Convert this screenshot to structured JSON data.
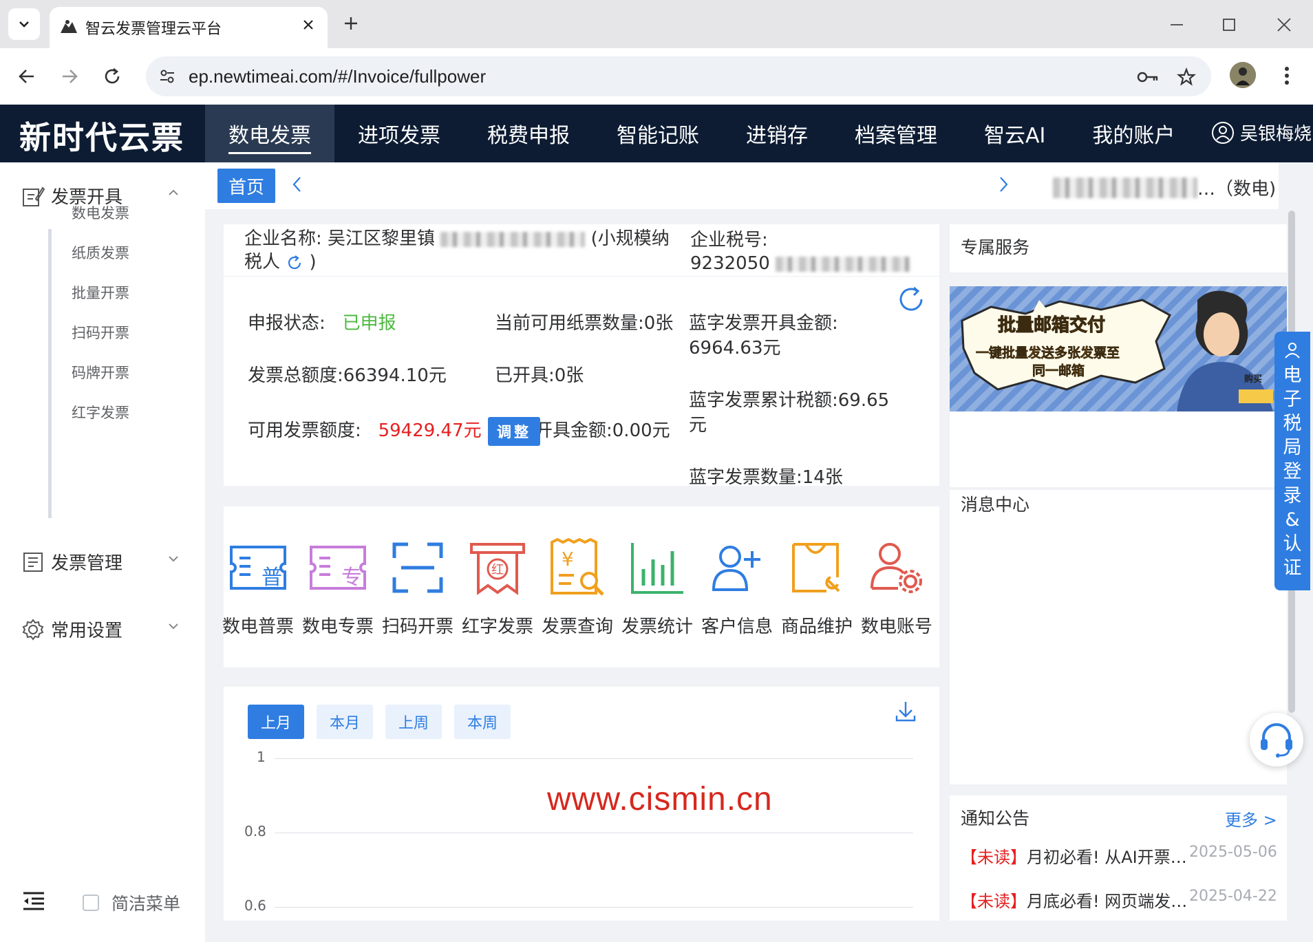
{
  "browser": {
    "tab_title": "智云发票管理云平台",
    "url": "ep.newtimeai.com/#/Invoice/fullpower"
  },
  "app": {
    "logo": "新时代云票",
    "nav": [
      "数电发票",
      "进项发票",
      "税费申报",
      "智能记账",
      "进销存",
      "档案管理",
      "智云AI",
      "我的账户"
    ],
    "active_nav": "数电发票",
    "user_name": "吴银梅烧"
  },
  "sidebar": {
    "group1": "发票开具",
    "group1_items": [
      "数电发票",
      "纸质发票",
      "批量开票",
      "扫码开票",
      "码牌开票",
      "红字发票"
    ],
    "group2": "发票管理",
    "group3": "常用设置",
    "simple_menu": "简洁菜单"
  },
  "breadcrumb": {
    "home": "首页",
    "company_suffix": "…（数电)"
  },
  "company": {
    "name_label": "企业名称:",
    "name_prefix": "吴江区黎里镇",
    "name_type": "(小规模纳",
    "name_type2": "税人",
    "name_close": ")",
    "tax_label": "企业税号:",
    "tax_prefix": "9232050"
  },
  "stats": {
    "declare_label": "申报状态:",
    "declare_value": "已申报",
    "paper_label": "当前可用纸票数量:",
    "paper_value": "0张",
    "blue_amount_label": "蓝字发票开具金额:",
    "blue_amount_value": "6964.63元",
    "total_label": "发票总额度:",
    "total_value": "66394.10元",
    "issued_label": "已开具:",
    "issued_value": "0张",
    "blue_tax_label": "蓝字发票累计税额:",
    "blue_tax_value": "69.65",
    "blue_tax_unit": "元",
    "available_label": "可用发票额度:",
    "available_value": "59429.47元",
    "adjust_btn": "调整",
    "issued_amount_label": "开具金额:",
    "issued_amount_value": "0.00元",
    "blue_count_label": "蓝字发票数量:",
    "blue_count_value": "14张"
  },
  "quick_actions": [
    {
      "label": "数电普票",
      "icon": "ordinary-invoice-icon"
    },
    {
      "label": "数电专票",
      "icon": "special-invoice-icon"
    },
    {
      "label": "扫码开票",
      "icon": "scan-icon"
    },
    {
      "label": "红字发票",
      "icon": "red-invoice-icon"
    },
    {
      "label": "发票查询",
      "icon": "invoice-search-icon"
    },
    {
      "label": "发票统计",
      "icon": "bar-chart-icon"
    },
    {
      "label": "客户信息",
      "icon": "add-user-icon"
    },
    {
      "label": "商品维护",
      "icon": "bag-wrench-icon"
    },
    {
      "label": "数电账号",
      "icon": "user-gear-icon"
    }
  ],
  "chart": {
    "periods": [
      "上月",
      "本月",
      "上周",
      "本周"
    ],
    "active_period": "上月",
    "watermark": "www.cismin.cn"
  },
  "chart_data": {
    "type": "line",
    "ylim": [
      0.6,
      1
    ],
    "yticks": [
      "1",
      "0.8",
      "0.6"
    ],
    "series": []
  },
  "right_panel": {
    "service_title": "专属服务",
    "banner_title": "批量邮箱交付",
    "banner_sub1": "一键批量发送多张发票至",
    "banner_sub2": "同一邮箱",
    "banner_buy": "购买",
    "message_title": "消息中心",
    "notice_title": "通知公告",
    "more": "更多 >",
    "notices": [
      {
        "tag": "【未读】",
        "text": "月初必看! 从AI开票…",
        "date": "2025-05-06"
      },
      {
        "tag": "【未读】",
        "text": "月底必看! 网页端发…",
        "date": "2025-04-22"
      }
    ]
  },
  "floating": {
    "login_text": "电子税局登录&认证"
  },
  "colors": {
    "header_bg": "#0d1c33",
    "primary": "#2f7de1",
    "success": "#4cba3f",
    "danger": "#e62020"
  }
}
